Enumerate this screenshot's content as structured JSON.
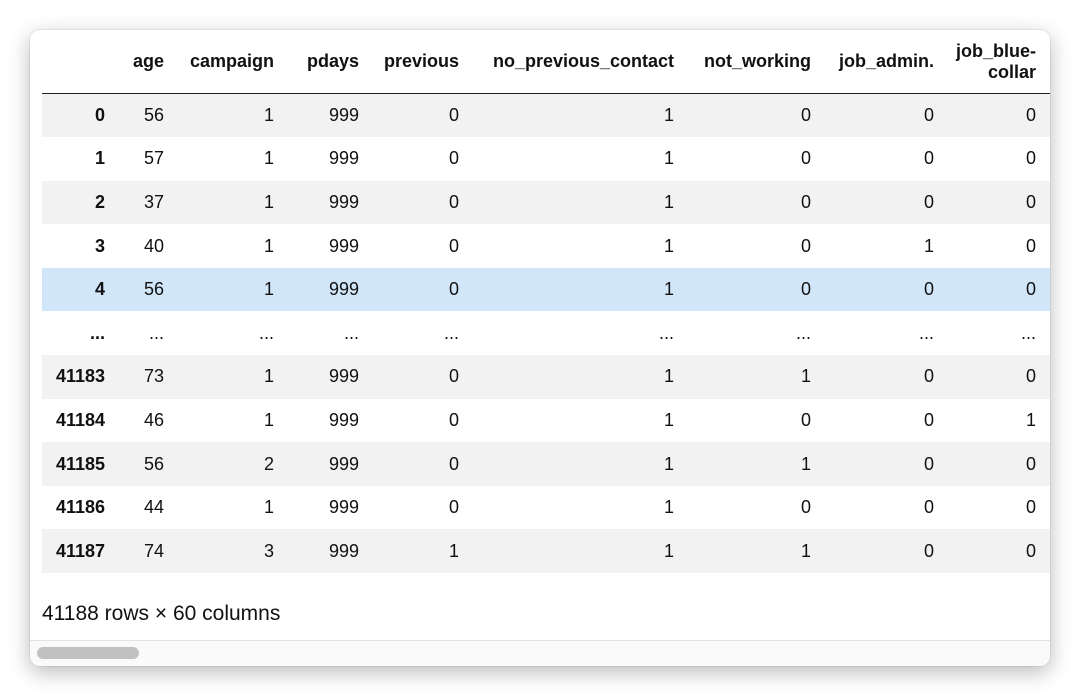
{
  "table": {
    "columns": [
      "",
      "age",
      "campaign",
      "pdays",
      "previous",
      "no_previous_contact",
      "not_working",
      "job_admin.",
      "job_blue-collar"
    ],
    "rows": [
      {
        "index": "0",
        "cells": [
          "56",
          "1",
          "999",
          "0",
          "1",
          "0",
          "0",
          "0"
        ]
      },
      {
        "index": "1",
        "cells": [
          "57",
          "1",
          "999",
          "0",
          "1",
          "0",
          "0",
          "0"
        ]
      },
      {
        "index": "2",
        "cells": [
          "37",
          "1",
          "999",
          "0",
          "1",
          "0",
          "0",
          "0"
        ]
      },
      {
        "index": "3",
        "cells": [
          "40",
          "1",
          "999",
          "0",
          "1",
          "0",
          "1",
          "0"
        ]
      },
      {
        "index": "4",
        "cells": [
          "56",
          "1",
          "999",
          "0",
          "1",
          "0",
          "0",
          "0"
        ]
      },
      {
        "index": "...",
        "cells": [
          "...",
          "...",
          "...",
          "...",
          "...",
          "...",
          "...",
          "..."
        ]
      },
      {
        "index": "41183",
        "cells": [
          "73",
          "1",
          "999",
          "0",
          "1",
          "1",
          "0",
          "0"
        ]
      },
      {
        "index": "41184",
        "cells": [
          "46",
          "1",
          "999",
          "0",
          "1",
          "0",
          "0",
          "1"
        ]
      },
      {
        "index": "41185",
        "cells": [
          "56",
          "2",
          "999",
          "0",
          "1",
          "1",
          "0",
          "0"
        ]
      },
      {
        "index": "41186",
        "cells": [
          "44",
          "1",
          "999",
          "0",
          "1",
          "0",
          "0",
          "0"
        ]
      },
      {
        "index": "41187",
        "cells": [
          "74",
          "3",
          "999",
          "1",
          "1",
          "1",
          "0",
          "0"
        ]
      }
    ]
  },
  "footer": {
    "summary": "41188 rows × 60 columns"
  },
  "colors": {
    "highlight_row": "#d2e6fa",
    "stripe": "#f2f2f2"
  }
}
